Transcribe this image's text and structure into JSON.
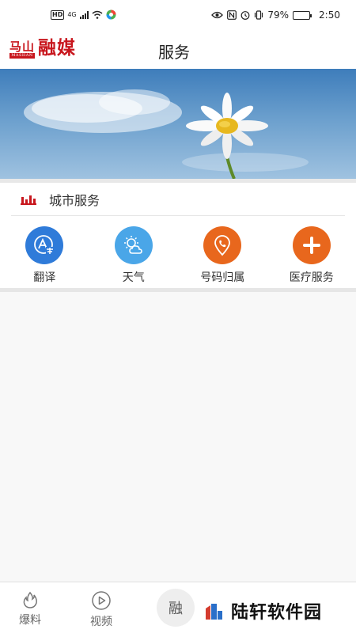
{
  "status_bar": {
    "hd": "HD",
    "net": "4G",
    "battery_text": "79%",
    "battery_level": 0.79,
    "time": "2:50"
  },
  "header": {
    "logo_small": "马山",
    "logo_sub": "MASHAN",
    "logo_big": "融媒",
    "title": "服务"
  },
  "city_services": {
    "title": "城市服务",
    "items": [
      {
        "label": "翻译",
        "icon": "translate-icon",
        "color": "#2f7bd9"
      },
      {
        "label": "天气",
        "icon": "weather-icon",
        "color": "#4aa6e8"
      },
      {
        "label": "号码归属",
        "icon": "phone-location-icon",
        "color": "#e8671d"
      },
      {
        "label": "医疗服务",
        "icon": "medical-plus-icon",
        "color": "#e8671d"
      }
    ]
  },
  "bottom_nav": {
    "items": [
      {
        "label": "爆料",
        "icon": "report-icon"
      },
      {
        "label": "视频",
        "icon": "video-play-icon"
      }
    ],
    "center_label": "融",
    "watermark_text": "陆轩软件园"
  },
  "colors": {
    "brand": "#c8161d",
    "orange": "#e8671d",
    "blue": "#2f7bd9"
  }
}
